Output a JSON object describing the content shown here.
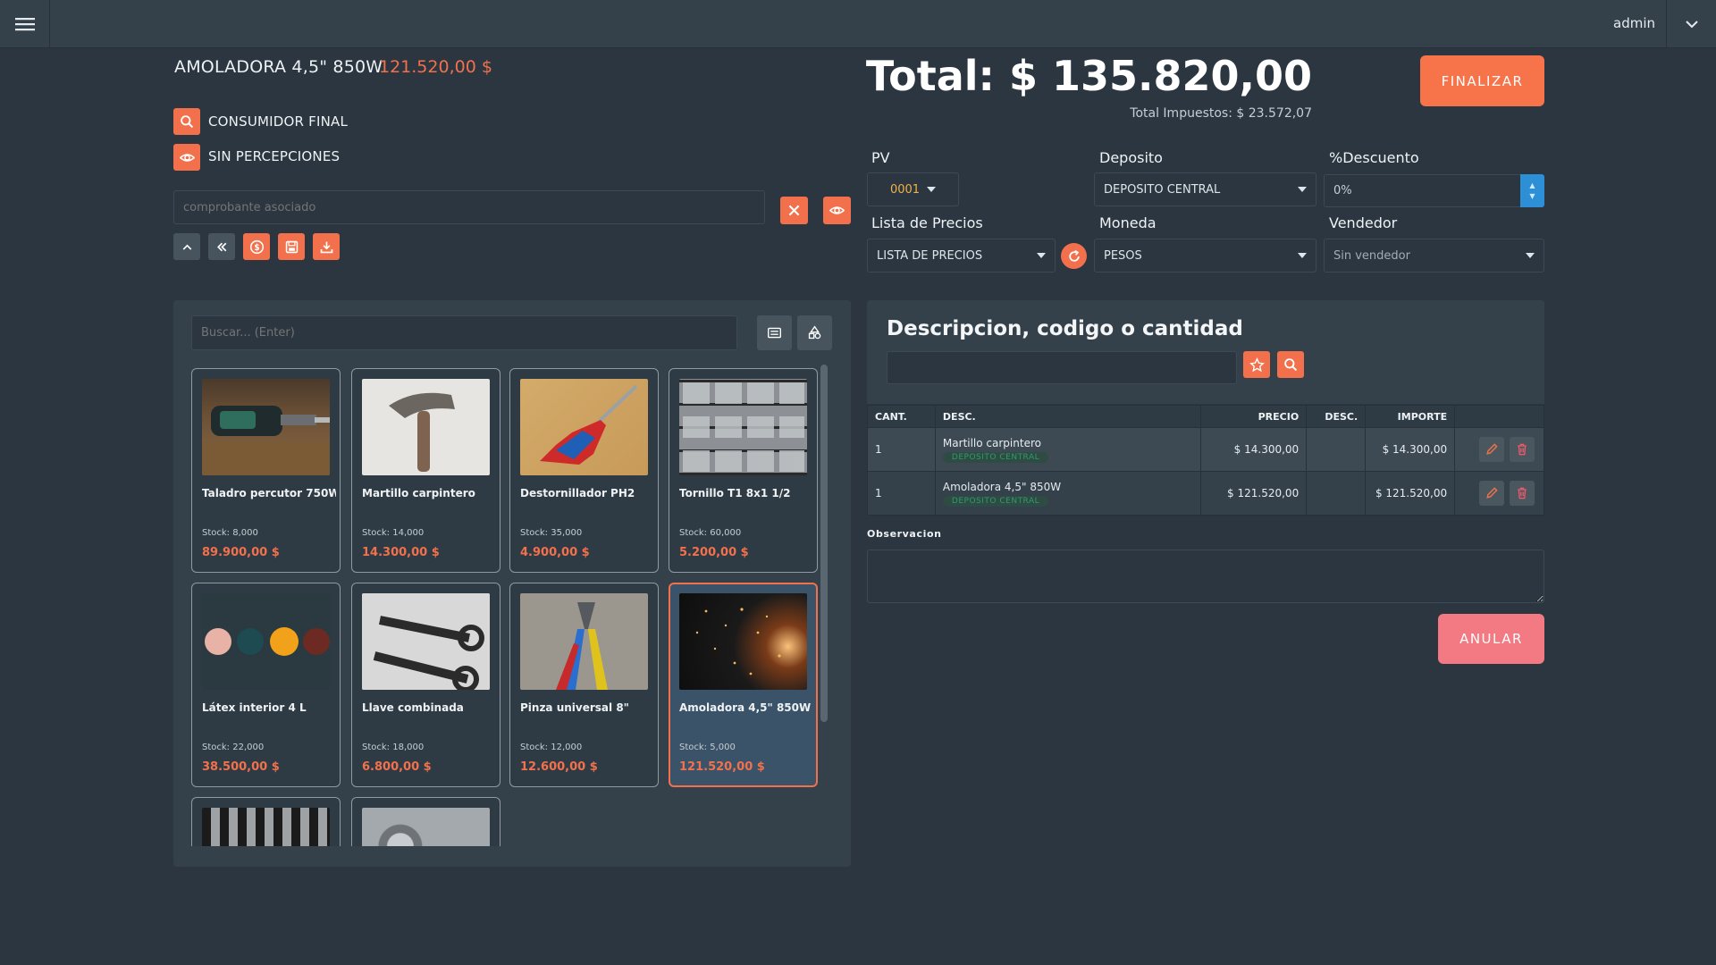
{
  "topbar": {
    "user": "admin"
  },
  "product": {
    "title": "AMOLADORA 4,5\" 850W",
    "price": "121.520,00 $"
  },
  "client": {
    "name": "CONSUMIDOR FINAL",
    "perception": "SIN PERCEPCIONES"
  },
  "assoc": {
    "placeholder": "comprobante asociado"
  },
  "totals": {
    "total": "Total: $ 135.820,00",
    "taxes": "Total Impuestos: $ 23.572,07"
  },
  "buttons": {
    "finalizar": "FINALIZAR",
    "anular": "ANULAR"
  },
  "fields": {
    "pv_label": "PV",
    "pv_value": "0001",
    "deposito_label": "Deposito",
    "deposito_value": "DEPOSITO CENTRAL",
    "descuento_label": "%Descuento",
    "descuento_value": "0%",
    "lista_label": "Lista de Precios",
    "lista_value": "LISTA DE PRECIOS",
    "moneda_label": "Moneda",
    "moneda_value": "PESOS",
    "vendedor_label": "Vendedor",
    "vendedor_value": "Sin vendedor"
  },
  "search": {
    "placeholder": "Buscar... (Enter)"
  },
  "products": [
    {
      "name": "Taladro percutor 750W",
      "stock": "Stock: 8,000",
      "price": "89.900,00 $"
    },
    {
      "name": "Martillo carpintero",
      "stock": "Stock: 14,000",
      "price": "14.300,00 $"
    },
    {
      "name": "Destornillador PH2",
      "stock": "Stock: 35,000",
      "price": "4.900,00 $"
    },
    {
      "name": "Tornillo T1 8x1 1/2",
      "stock": "Stock: 60,000",
      "price": "5.200,00 $"
    },
    {
      "name": "Látex interior 4 L",
      "stock": "Stock: 22,000",
      "price": "38.500,00 $"
    },
    {
      "name": "Llave combinada",
      "stock": "Stock: 18,000",
      "price": "6.800,00 $"
    },
    {
      "name": "Pinza universal 8\"",
      "stock": "Stock: 12,000",
      "price": "12.600,00 $"
    },
    {
      "name": "Amoladora 4,5\" 850W",
      "stock": "Stock: 5,000",
      "price": "121.520,00 $"
    }
  ],
  "entry": {
    "title": "Descripcion, codigo o cantidad"
  },
  "table": {
    "headers": [
      "CANT.",
      "DESC.",
      "PRECIO",
      "DESC.",
      "IMPORTE"
    ],
    "rows": [
      {
        "qty": "1",
        "desc": "Martillo carpintero",
        "badge": "DEPOSITO CENTRAL",
        "price": "$ 14.300,00",
        "disc": "",
        "amount": "$ 14.300,00"
      },
      {
        "qty": "1",
        "desc": "Amoladora 4,5\" 850W",
        "badge": "DEPOSITO CENTRAL",
        "price": "$ 121.520,00",
        "disc": "",
        "amount": "$ 121.520,00"
      }
    ]
  },
  "observacion": {
    "label": "Observacion"
  }
}
